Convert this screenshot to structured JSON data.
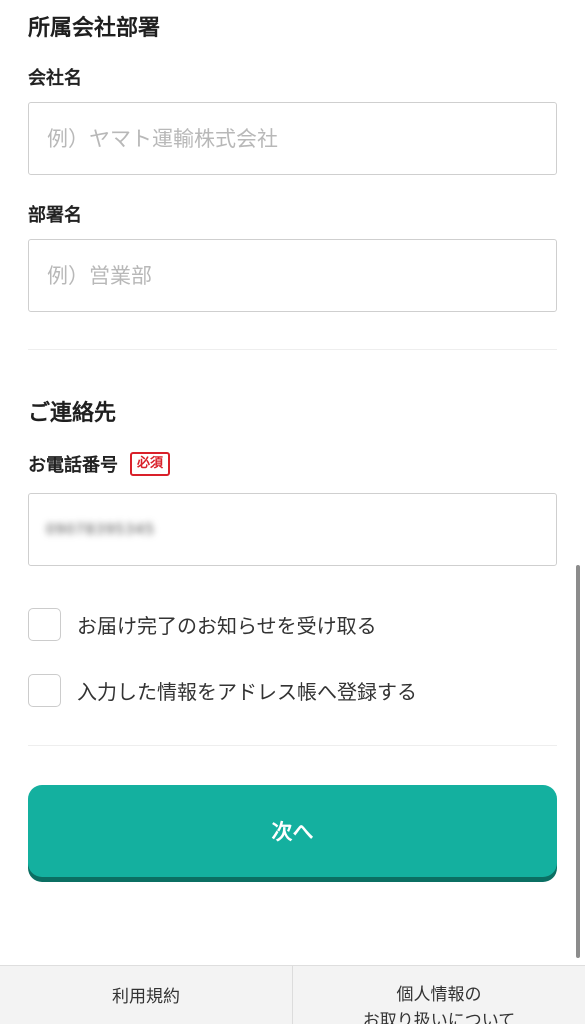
{
  "company_section": {
    "title": "所属会社部署",
    "company_name": {
      "label": "会社名",
      "placeholder": "例）ヤマト運輸株式会社",
      "value": ""
    },
    "department_name": {
      "label": "部署名",
      "placeholder": "例）営業部",
      "value": ""
    }
  },
  "contact_section": {
    "title": "ご連絡先",
    "phone": {
      "label": "お電話番号",
      "required_badge": "必須",
      "value": "09078395345"
    }
  },
  "options": [
    {
      "label": "お届け完了のお知らせを受け取る",
      "checked": false
    },
    {
      "label": "入力した情報をアドレス帳へ登録する",
      "checked": false
    }
  ],
  "next_button": {
    "label": "次へ",
    "color": "#14b09f"
  },
  "footer": {
    "terms_label": "利用規約",
    "privacy_label_line1": "個人情報の",
    "privacy_label_line2": "お取り扱いについて"
  },
  "colors": {
    "required": "#d9202a",
    "button": "#14b09f",
    "button_shadow": "#0b6f63"
  }
}
